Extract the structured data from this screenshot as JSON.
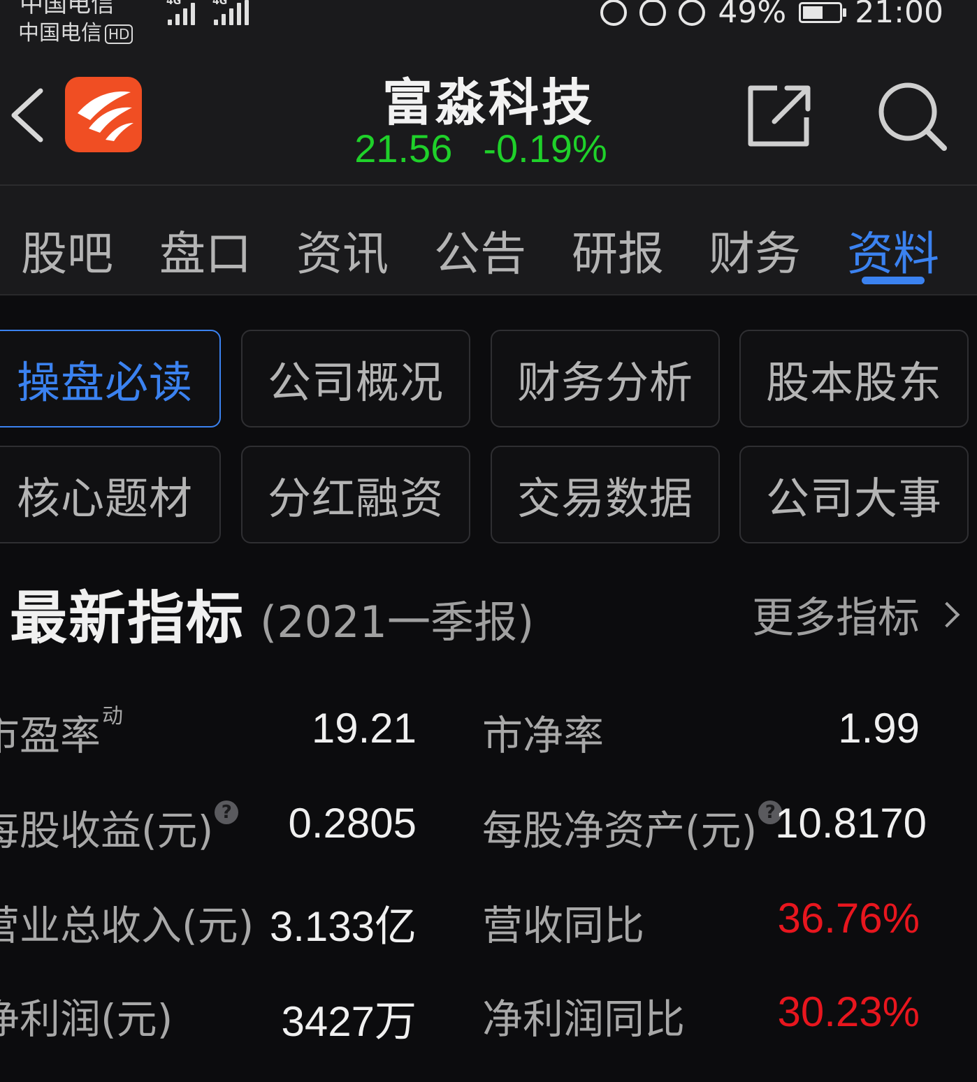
{
  "status_bar": {
    "carrier_top": "中国电信",
    "carrier": "中国电信",
    "hd": "HD",
    "network_1": "4G",
    "network_2": "4G",
    "battery": "49%",
    "time": "21:00"
  },
  "header": {
    "title": "富淼科技",
    "price": "21.56",
    "change_pct": "-0.19%",
    "price_color": "#1fd12a"
  },
  "tabs": [
    {
      "label": "股吧"
    },
    {
      "label": "盘口"
    },
    {
      "label": "资讯"
    },
    {
      "label": "公告"
    },
    {
      "label": "研报"
    },
    {
      "label": "财务"
    },
    {
      "label": "资料",
      "active": true
    }
  ],
  "sub_buttons": [
    {
      "label": "操盘必读",
      "active": true
    },
    {
      "label": "公司概况"
    },
    {
      "label": "财务分析"
    },
    {
      "label": "股本股东"
    },
    {
      "label": "核心题材"
    },
    {
      "label": "分红融资"
    },
    {
      "label": "交易数据"
    },
    {
      "label": "公司大事"
    }
  ],
  "section": {
    "title": "最新指标",
    "subtitle": "(2021一季报)",
    "more": "更多指标"
  },
  "metrics": [
    {
      "label": "市盈率",
      "sup": "动",
      "value": "19.21"
    },
    {
      "label": "市净率",
      "value": "1.99"
    },
    {
      "label": "每股收益(元)",
      "help": "?",
      "value": "0.2805"
    },
    {
      "label": "每股净资产(元)",
      "help": "?",
      "value": "10.8170"
    },
    {
      "label": "营业总收入(元)",
      "value": "3.133亿"
    },
    {
      "label": "营收同比",
      "value": "36.76%",
      "color": "#e8161e"
    },
    {
      "label": "净利润(元)",
      "value": "3427万"
    },
    {
      "label": "净利润同比",
      "value": "30.23%",
      "color": "#e8161e"
    }
  ],
  "colors": {
    "accent": "#3b82f0",
    "up": "#e8161e",
    "down": "#1fd12a",
    "background": "#0c0c0e",
    "panel": "#1a1a1c"
  }
}
